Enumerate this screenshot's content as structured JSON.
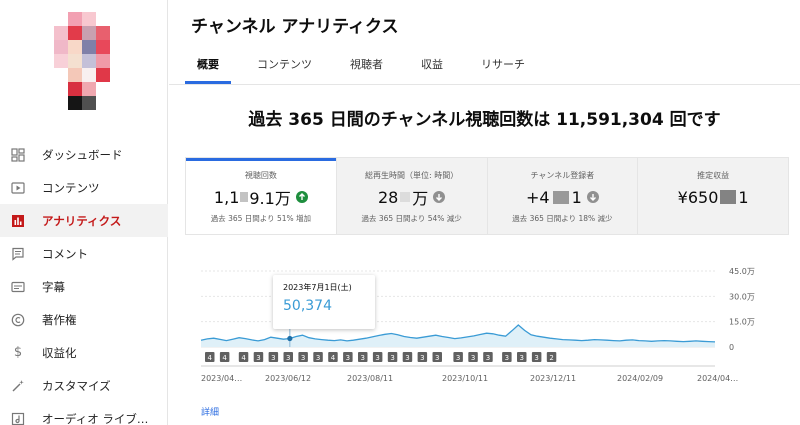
{
  "sidebar": {
    "items": [
      {
        "label": "ダッシュボード",
        "icon": "dashboard-icon",
        "active": false
      },
      {
        "label": "コンテンツ",
        "icon": "content-icon",
        "active": false
      },
      {
        "label": "アナリティクス",
        "icon": "analytics-icon",
        "active": true
      },
      {
        "label": "コメント",
        "icon": "comment-icon",
        "active": false
      },
      {
        "label": "字幕",
        "icon": "subtitles-icon",
        "active": false
      },
      {
        "label": "著作権",
        "icon": "copyright-icon",
        "active": false
      },
      {
        "label": "収益化",
        "icon": "dollar-icon",
        "active": false
      },
      {
        "label": "カスタマイズ",
        "icon": "magic-wand-icon",
        "active": false
      },
      {
        "label": "オーディオ ライブ…",
        "icon": "audio-library-icon",
        "active": false
      }
    ]
  },
  "header": {
    "title": "チャンネル アナリティクス",
    "tabs": [
      "概要",
      "コンテンツ",
      "視聴者",
      "収益",
      "リサーチ"
    ],
    "active_tab": "概要"
  },
  "headline": "過去 365 日間のチャンネル視聴回数は 11,591,304 回です",
  "cards": [
    {
      "label": "視聴回数",
      "value_a": "1,1",
      "value_b": "9.1万",
      "sub": "過去 365 日間より 51% 増加",
      "trend": "up"
    },
    {
      "label": "総再生時間（単位: 時間）",
      "value_a": "28",
      "value_b": "万",
      "sub": "過去 365 日間より 54% 減少",
      "trend": "down"
    },
    {
      "label": "チャンネル登録者",
      "value_a": "+4",
      "value_b": "1",
      "sub": "過去 365 日間より 18% 減少",
      "trend": "down"
    },
    {
      "label": "推定収益",
      "value_a": "¥650",
      "value_b": "1",
      "sub": "",
      "trend": "none"
    }
  ],
  "tooltip": {
    "date": "2023年7月1日(土)",
    "value": "50,374"
  },
  "chart_data": {
    "type": "area",
    "y_ticks": [
      "45.0万",
      "30.0万",
      "15.0万",
      "0"
    ],
    "x_ticks": [
      "2023/04…",
      "2023/06/12",
      "2023/08/11",
      "2023/10/11",
      "2023/12/11",
      "2024/02/09",
      "2024/04…"
    ],
    "ylim": [
      0,
      450000
    ],
    "values": [
      40000,
      48000,
      52000,
      45000,
      38000,
      46000,
      55000,
      50000,
      42000,
      36000,
      44000,
      58000,
      52000,
      46000,
      50374,
      62000,
      70000,
      55000,
      48000,
      44000,
      40000,
      38000,
      42000,
      36000,
      40000,
      46000,
      52000,
      60000,
      68000,
      75000,
      80000,
      72000,
      62000,
      56000,
      52000,
      58000,
      64000,
      70000,
      62000,
      56000,
      50000,
      54000,
      60000,
      66000,
      74000,
      82000,
      78000,
      70000,
      64000,
      96000,
      130000,
      98000,
      72000,
      64000,
      58000,
      52000,
      48000,
      44000,
      42000,
      40000,
      38000,
      40000,
      44000,
      42000,
      40000,
      38000,
      36000,
      40000,
      42000,
      38000,
      36000,
      34000,
      36000,
      38000,
      36000,
      34000,
      32000,
      34000,
      36000,
      34000,
      32000,
      30000
    ],
    "badges": [
      "4",
      "4",
      "4",
      "3",
      "3",
      "3",
      "3",
      "3",
      "4",
      "3",
      "3",
      "3",
      "3",
      "3",
      "3",
      "3",
      "3",
      "3",
      "3",
      "3",
      "3",
      "3",
      "2"
    ],
    "accent": "#3a9bd5"
  },
  "detail_link": "詳細"
}
